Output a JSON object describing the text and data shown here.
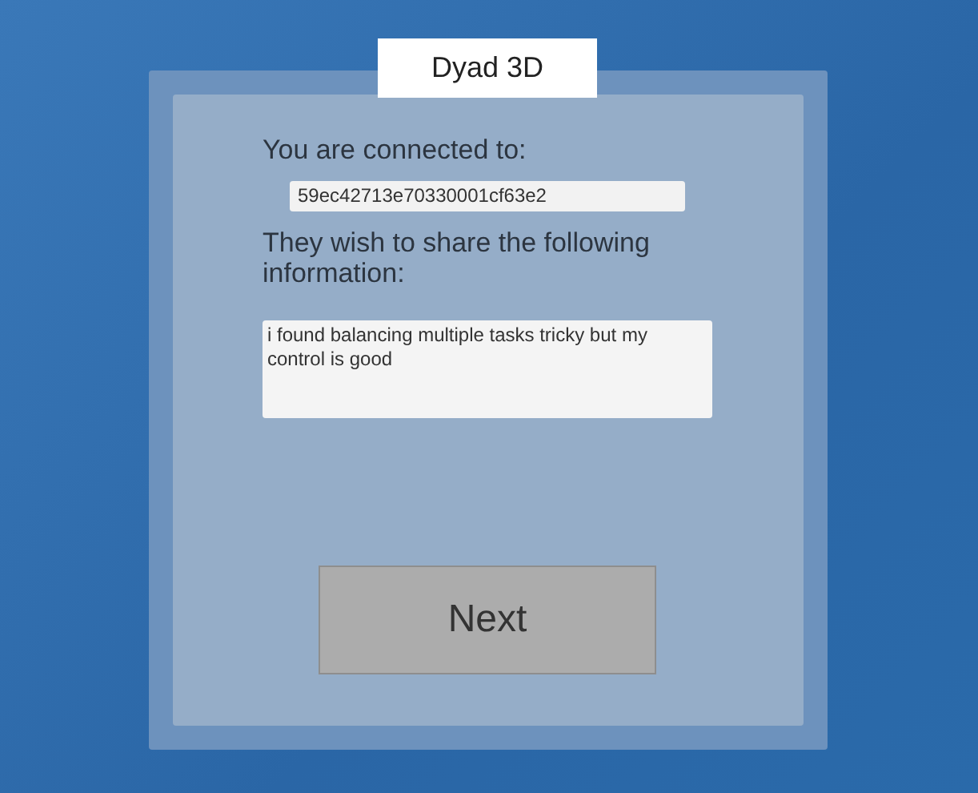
{
  "title": "Dyad 3D",
  "connected_label": "You are connected to:",
  "partner_id": "59ec42713e70330001cf63e2",
  "share_label": "They wish to share the following information:",
  "shared_info": "i found balancing multiple tasks tricky but my control is good",
  "button": "Next"
}
